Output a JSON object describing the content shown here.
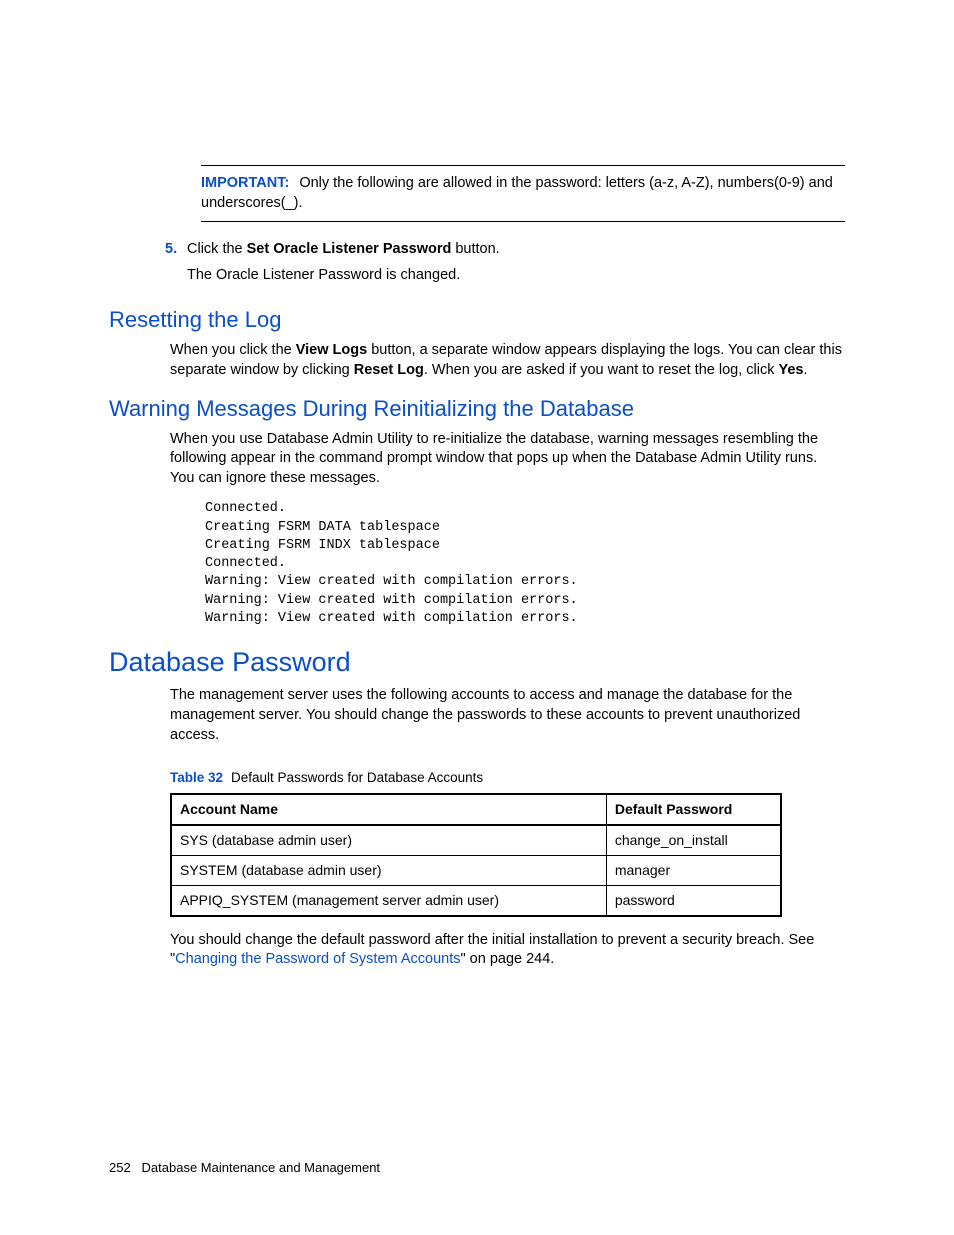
{
  "callout": {
    "label": "IMPORTANT:",
    "text_before": "Only the following are allowed in the password: letters (a-z, A-Z), numbers(0-9) and underscores(_)."
  },
  "step5": {
    "num": "5.",
    "line1_a": "Click the ",
    "line1_bold": "Set Oracle Listener Password",
    "line1_b": " button.",
    "line2": "The Oracle Listener Password is changed."
  },
  "reset_log": {
    "heading": "Resetting the Log",
    "p_a": "When you click the ",
    "p_bold1": "View Logs",
    "p_b": " button, a separate window appears displaying the logs. You can clear this separate window by clicking ",
    "p_bold2": "Reset Log",
    "p_c": ". When you are asked if you want to reset the log, click ",
    "p_bold3": "Yes",
    "p_d": "."
  },
  "warn": {
    "heading": "Warning Messages During Reinitializing the Database",
    "p": "When you use Database Admin Utility to re-initialize the database, warning messages resembling the following appear in the command prompt window that pops up when the Database Admin Utility runs. You can ignore these messages.",
    "code": "Connected.\nCreating FSRM DATA tablespace\nCreating FSRM INDX tablespace\nConnected.\nWarning: View created with compilation errors.\nWarning: View created with compilation errors.\nWarning: View created with compilation errors."
  },
  "dbpass": {
    "heading": "Database Password",
    "p": "The management server uses the following accounts to access and manage the database for the management server. You should change the passwords to these accounts to prevent unauthorized access.",
    "table_num": "Table 32",
    "table_title": "Default Passwords for Database Accounts",
    "headers": {
      "c0": "Account Name",
      "c1": "Default Password"
    },
    "rows": [
      {
        "c0": "SYS (database admin user)",
        "c1": "change_on_install"
      },
      {
        "c0": "SYSTEM (database admin user)",
        "c1": "manager"
      },
      {
        "c0": "APPIQ_SYSTEM (management server admin user)",
        "c1": "password"
      }
    ],
    "after_a": "You should change the default password after the initial installation to prevent a security breach. See \"",
    "after_link": "Changing the Password of System Accounts",
    "after_b": "\" on page 244."
  },
  "footer": {
    "page": "252",
    "title": "Database Maintenance and Management"
  }
}
